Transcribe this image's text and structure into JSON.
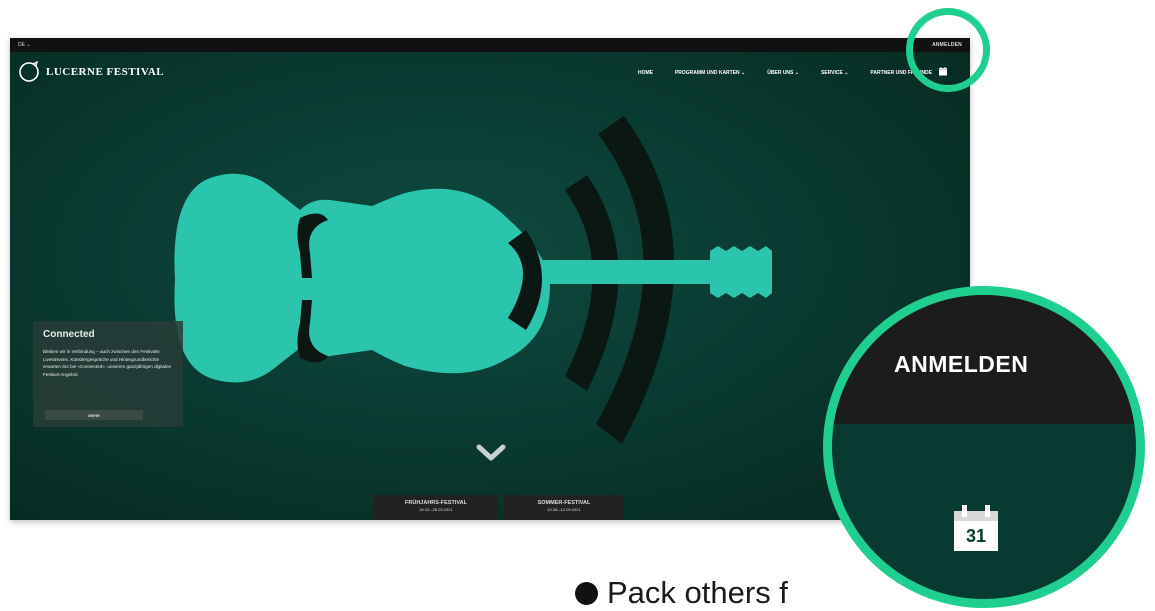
{
  "topbar": {
    "lang": "DE ⌄",
    "login": "ANMELDEN"
  },
  "logo": {
    "text": "LUCERNE FESTIVAL"
  },
  "nav": [
    {
      "label": "HOME"
    },
    {
      "label": "PROGRAMM UND KARTEN ⌄"
    },
    {
      "label": "ÜBER UNS ⌄"
    },
    {
      "label": "SERVICE ⌄"
    },
    {
      "label": "PARTNER UND FREUNDE"
    }
  ],
  "card": {
    "title": "Connected",
    "body": "Bleiben wir in Verbindung – auch zwischen den Festivals! Livestreams, Künstlergespräche und Hintergrundberichte erwarten Sie bei «Connected», unserem ganzjährigen digitalen Festival-Angebot.",
    "more": "MEHR"
  },
  "festivals": [
    {
      "title": "FRÜHJAHRS-FESTIVAL",
      "dates": "26.03.–28.03.2021"
    },
    {
      "title": "SOMMER-FESTIVAL",
      "dates": "10.08.–12.09.2021"
    }
  ],
  "zoom": {
    "login": "ANMELDEN",
    "calendar_day": "31"
  },
  "legend": {
    "text": "Pack others f"
  },
  "colors": {
    "highlight": "#1fcf8f",
    "background": "#0a3b32",
    "violin": "#2bc4ad"
  }
}
